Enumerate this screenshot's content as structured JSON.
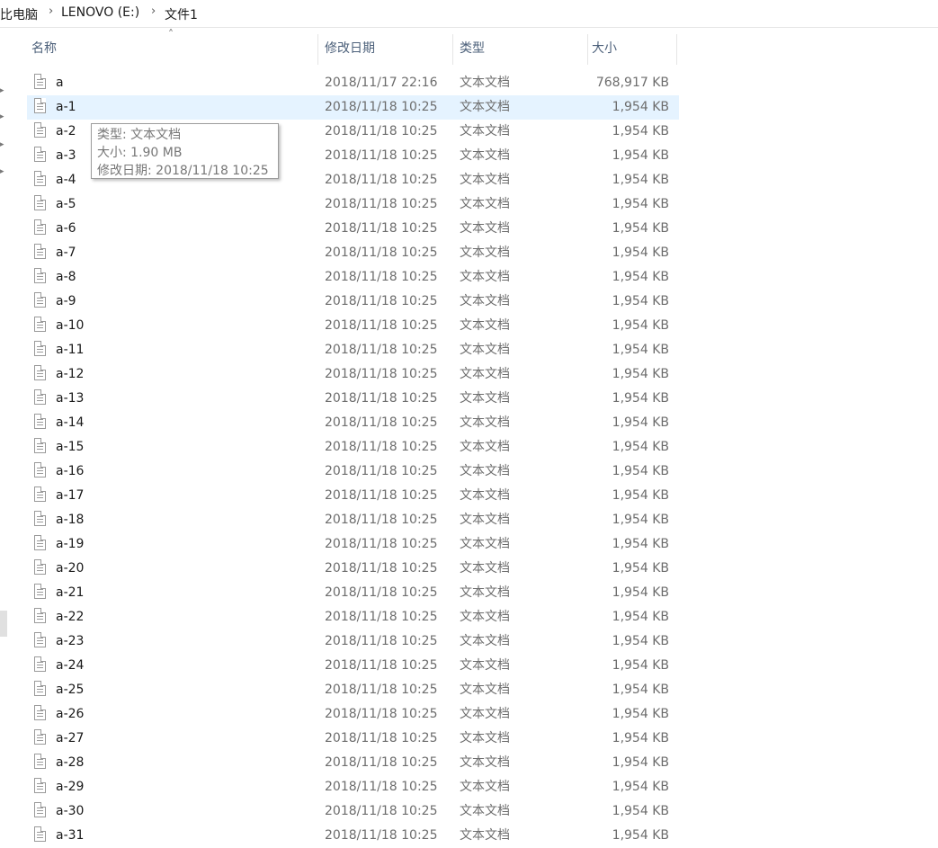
{
  "breadcrumb": {
    "items": [
      "比电脑",
      "LENOVO (E:)",
      "文件1"
    ]
  },
  "columns": {
    "name": "名称",
    "date": "修改日期",
    "type": "类型",
    "size": "大小"
  },
  "tooltip": {
    "type_line": "类型: 文本文档",
    "size_line": "大小: 1.90 MB",
    "date_line": "修改日期: 2018/11/18 10:25"
  },
  "files": [
    {
      "name": "a",
      "date": "2018/11/17 22:16",
      "type": "文本文档",
      "size": "768,917 KB"
    },
    {
      "name": "a-1",
      "date": "2018/11/18 10:25",
      "type": "文本文档",
      "size": "1,954 KB",
      "selected": true
    },
    {
      "name": "a-2",
      "date": "2018/11/18 10:25",
      "type": "文本文档",
      "size": "1,954 KB"
    },
    {
      "name": "a-3",
      "date": "2018/11/18 10:25",
      "type": "文本文档",
      "size": "1,954 KB"
    },
    {
      "name": "a-4",
      "date": "2018/11/18 10:25",
      "type": "文本文档",
      "size": "1,954 KB"
    },
    {
      "name": "a-5",
      "date": "2018/11/18 10:25",
      "type": "文本文档",
      "size": "1,954 KB"
    },
    {
      "name": "a-6",
      "date": "2018/11/18 10:25",
      "type": "文本文档",
      "size": "1,954 KB"
    },
    {
      "name": "a-7",
      "date": "2018/11/18 10:25",
      "type": "文本文档",
      "size": "1,954 KB"
    },
    {
      "name": "a-8",
      "date": "2018/11/18 10:25",
      "type": "文本文档",
      "size": "1,954 KB"
    },
    {
      "name": "a-9",
      "date": "2018/11/18 10:25",
      "type": "文本文档",
      "size": "1,954 KB"
    },
    {
      "name": "a-10",
      "date": "2018/11/18 10:25",
      "type": "文本文档",
      "size": "1,954 KB"
    },
    {
      "name": "a-11",
      "date": "2018/11/18 10:25",
      "type": "文本文档",
      "size": "1,954 KB"
    },
    {
      "name": "a-12",
      "date": "2018/11/18 10:25",
      "type": "文本文档",
      "size": "1,954 KB"
    },
    {
      "name": "a-13",
      "date": "2018/11/18 10:25",
      "type": "文本文档",
      "size": "1,954 KB"
    },
    {
      "name": "a-14",
      "date": "2018/11/18 10:25",
      "type": "文本文档",
      "size": "1,954 KB"
    },
    {
      "name": "a-15",
      "date": "2018/11/18 10:25",
      "type": "文本文档",
      "size": "1,954 KB"
    },
    {
      "name": "a-16",
      "date": "2018/11/18 10:25",
      "type": "文本文档",
      "size": "1,954 KB"
    },
    {
      "name": "a-17",
      "date": "2018/11/18 10:25",
      "type": "文本文档",
      "size": "1,954 KB"
    },
    {
      "name": "a-18",
      "date": "2018/11/18 10:25",
      "type": "文本文档",
      "size": "1,954 KB"
    },
    {
      "name": "a-19",
      "date": "2018/11/18 10:25",
      "type": "文本文档",
      "size": "1,954 KB"
    },
    {
      "name": "a-20",
      "date": "2018/11/18 10:25",
      "type": "文本文档",
      "size": "1,954 KB"
    },
    {
      "name": "a-21",
      "date": "2018/11/18 10:25",
      "type": "文本文档",
      "size": "1,954 KB"
    },
    {
      "name": "a-22",
      "date": "2018/11/18 10:25",
      "type": "文本文档",
      "size": "1,954 KB"
    },
    {
      "name": "a-23",
      "date": "2018/11/18 10:25",
      "type": "文本文档",
      "size": "1,954 KB"
    },
    {
      "name": "a-24",
      "date": "2018/11/18 10:25",
      "type": "文本文档",
      "size": "1,954 KB"
    },
    {
      "name": "a-25",
      "date": "2018/11/18 10:25",
      "type": "文本文档",
      "size": "1,954 KB"
    },
    {
      "name": "a-26",
      "date": "2018/11/18 10:25",
      "type": "文本文档",
      "size": "1,954 KB"
    },
    {
      "name": "a-27",
      "date": "2018/11/18 10:25",
      "type": "文本文档",
      "size": "1,954 KB"
    },
    {
      "name": "a-28",
      "date": "2018/11/18 10:25",
      "type": "文本文档",
      "size": "1,954 KB"
    },
    {
      "name": "a-29",
      "date": "2018/11/18 10:25",
      "type": "文本文档",
      "size": "1,954 KB"
    },
    {
      "name": "a-30",
      "date": "2018/11/18 10:25",
      "type": "文本文档",
      "size": "1,954 KB"
    },
    {
      "name": "a-31",
      "date": "2018/11/18 10:25",
      "type": "文本文档",
      "size": "1,954 KB"
    }
  ]
}
